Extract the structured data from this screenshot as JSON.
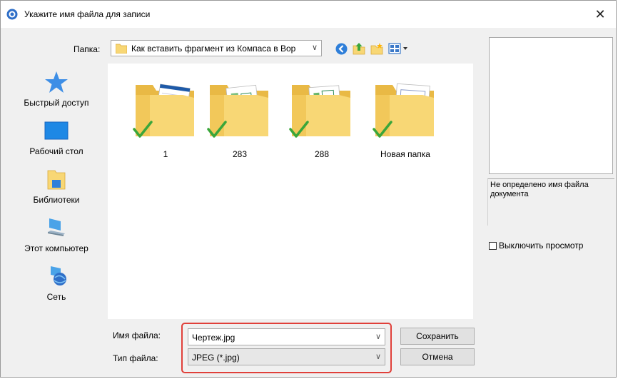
{
  "window": {
    "title": "Укажите имя файла для записи",
    "close_glyph": "✕"
  },
  "folder_bar": {
    "label": "Папка:",
    "current": "Как вставить фрагмент из Компаса в Вор",
    "arrow": "∨",
    "tools": [
      "back-icon",
      "up-folder-icon",
      "new-folder-icon",
      "view-menu-icon"
    ]
  },
  "places": [
    {
      "label": "Быстрый доступ",
      "icon": "quick-access-star-icon"
    },
    {
      "label": "Рабочий стол",
      "icon": "desktop-icon"
    },
    {
      "label": "Библиотеки",
      "icon": "libraries-icon"
    },
    {
      "label": "Этот компьютер",
      "icon": "computer-icon"
    },
    {
      "label": "Сеть",
      "icon": "network-icon"
    }
  ],
  "files": [
    {
      "name": "1",
      "icon": "folder-synced-icon"
    },
    {
      "name": "283",
      "icon": "folder-synced-icon"
    },
    {
      "name": "288",
      "icon": "folder-synced-icon"
    },
    {
      "name": "Новая папка",
      "icon": "folder-synced-icon"
    }
  ],
  "filename": {
    "label": "Имя файла:",
    "value": "Чертеж.jpg",
    "arrow": "∨"
  },
  "filetype": {
    "label": "Тип файла:",
    "value": "JPEG (*.jpg)",
    "arrow": "∨"
  },
  "buttons": {
    "save": "Сохранить",
    "cancel": "Отмена"
  },
  "preview": {
    "info": "Не определено имя файла документа",
    "disable_preview": "Выключить просмотр"
  },
  "colors": {
    "highlight": "#e0403a",
    "folder": "#f8d775",
    "check": "#3aa63a"
  }
}
